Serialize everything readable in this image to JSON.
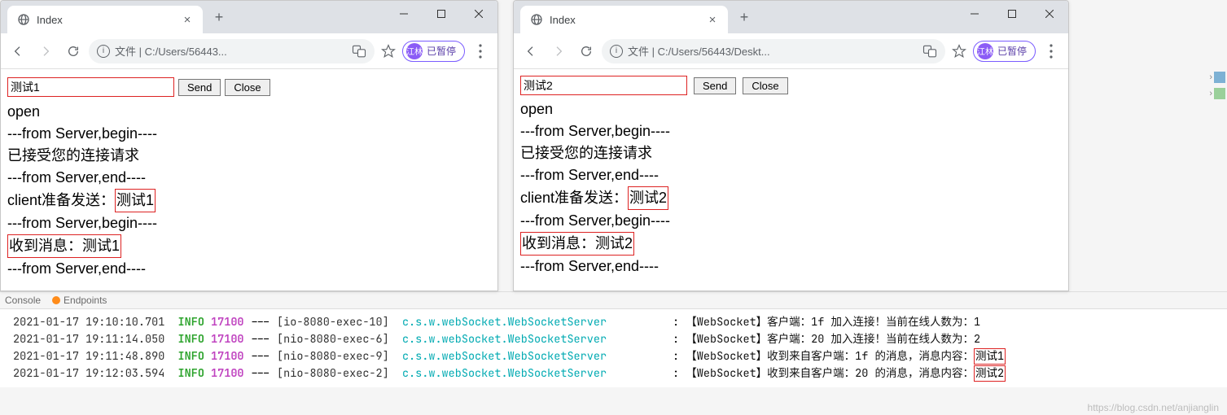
{
  "windows": [
    {
      "tab_title": "Index",
      "url_text": "文件 | C:/Users/56443...",
      "pill_avatar": "江林",
      "pill_text": "已暂停",
      "input_value": "测试1",
      "send_label": "Send",
      "close_label": "Close",
      "log": {
        "l1": "open",
        "l2": "---from Server,begin----",
        "l3": "已接受您的连接请求",
        "l4": "---from Server,end----",
        "l5a": "client准备发送：",
        "l5b": "测试1",
        "l6": "---from Server,begin----",
        "l7": "收到消息：测试1",
        "l8": "---from Server,end----"
      }
    },
    {
      "tab_title": "Index",
      "url_text": "文件 | C:/Users/56443/Deskt...",
      "pill_avatar": "江林",
      "pill_text": "已暂停",
      "input_value": "测试2",
      "send_label": "Send",
      "close_label": "Close",
      "log": {
        "l1": "open",
        "l2": "---from Server,begin----",
        "l3": "已接受您的连接请求",
        "l4": "---from Server,end----",
        "l5a": "client准备发送：",
        "l5b": "测试2",
        "l6": "---from Server,begin----",
        "l7": "收到消息：测试2",
        "l8": "---from Server,end----"
      }
    }
  ],
  "toolbar": {
    "console": "Console",
    "endpoints": "Endpoints"
  },
  "console": {
    "level": "INFO",
    "pid": "17100",
    "class": "c.s.w.webSocket.WebSocketServer",
    "rows": [
      {
        "ts": "2021-01-17 19:10:10.701",
        "thr": "[io-8080-exec-10]",
        "msg": "【WebSocket】客户端：1f 加入连接！当前在线人数为：1",
        "boxed": ""
      },
      {
        "ts": "2021-01-17 19:11:14.050",
        "thr": "[nio-8080-exec-6]",
        "msg": "【WebSocket】客户端：20 加入连接！当前在线人数为：2",
        "boxed": ""
      },
      {
        "ts": "2021-01-17 19:11:48.890",
        "thr": "[nio-8080-exec-9]",
        "msg": "【WebSocket】收到来自客户端：1f 的消息，消息内容：",
        "boxed": "测试1"
      },
      {
        "ts": "2021-01-17 19:12:03.594",
        "thr": "[nio-8080-exec-2]",
        "msg": "【WebSocket】收到来自客户端：20 的消息，消息内容：",
        "boxed": "测试2"
      }
    ]
  },
  "watermark": "https://blog.csdn.net/anjianglin"
}
